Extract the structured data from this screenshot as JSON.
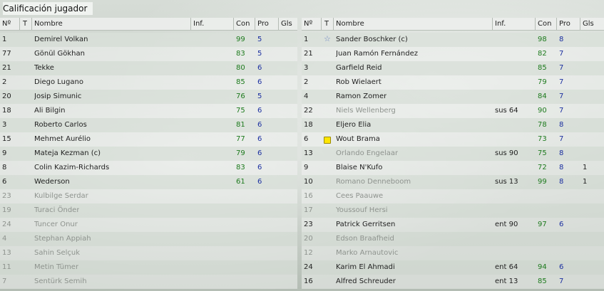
{
  "title": "Calificación jugador",
  "columns": {
    "num": "Nº",
    "t": "T",
    "name": "Nombre",
    "inf": "Inf.",
    "con": "Con",
    "pro": "Pro",
    "gls": "Gls"
  },
  "left_team": [
    {
      "num": "1",
      "name": "Demirel Volkan",
      "inf": "",
      "con": "99",
      "pro": "5",
      "gls": "",
      "played": true,
      "icon": ""
    },
    {
      "num": "77",
      "name": "Gönül Gökhan",
      "inf": "",
      "con": "83",
      "pro": "5",
      "gls": "",
      "played": true,
      "icon": ""
    },
    {
      "num": "21",
      "name": "Tekke",
      "inf": "",
      "con": "80",
      "pro": "6",
      "gls": "",
      "played": true,
      "icon": ""
    },
    {
      "num": "2",
      "name": "Diego Lugano",
      "inf": "",
      "con": "85",
      "pro": "6",
      "gls": "",
      "played": true,
      "icon": ""
    },
    {
      "num": "20",
      "name": "Josip Simunic",
      "inf": "",
      "con": "76",
      "pro": "5",
      "gls": "",
      "played": true,
      "icon": ""
    },
    {
      "num": "18",
      "name": "Ali Bilgin",
      "inf": "",
      "con": "75",
      "pro": "6",
      "gls": "",
      "played": true,
      "icon": ""
    },
    {
      "num": "3",
      "name": "Roberto Carlos",
      "inf": "",
      "con": "81",
      "pro": "6",
      "gls": "",
      "played": true,
      "icon": ""
    },
    {
      "num": "15",
      "name": "Mehmet Aurélio",
      "inf": "",
      "con": "77",
      "pro": "6",
      "gls": "",
      "played": true,
      "icon": ""
    },
    {
      "num": "9",
      "name": "Mateja Kezman (c)",
      "inf": "",
      "con": "79",
      "pro": "6",
      "gls": "",
      "played": true,
      "icon": ""
    },
    {
      "num": "8",
      "name": "Colin Kazim-Richards",
      "inf": "",
      "con": "83",
      "pro": "6",
      "gls": "",
      "played": true,
      "icon": ""
    },
    {
      "num": "6",
      "name": "Wederson",
      "inf": "",
      "con": "61",
      "pro": "6",
      "gls": "",
      "played": true,
      "icon": ""
    },
    {
      "num": "23",
      "name": "Kulbilge Serdar",
      "inf": "",
      "con": "",
      "pro": "",
      "gls": "",
      "played": false,
      "icon": ""
    },
    {
      "num": "19",
      "name": "Turaci Önder",
      "inf": "",
      "con": "",
      "pro": "",
      "gls": "",
      "played": false,
      "icon": ""
    },
    {
      "num": "24",
      "name": "Tuncer Onur",
      "inf": "",
      "con": "",
      "pro": "",
      "gls": "",
      "played": false,
      "icon": ""
    },
    {
      "num": "4",
      "name": "Stephan Appiah",
      "inf": "",
      "con": "",
      "pro": "",
      "gls": "",
      "played": false,
      "icon": ""
    },
    {
      "num": "13",
      "name": "Sahin Selçuk",
      "inf": "",
      "con": "",
      "pro": "",
      "gls": "",
      "played": false,
      "icon": ""
    },
    {
      "num": "11",
      "name": "Metin Tümer",
      "inf": "",
      "con": "",
      "pro": "",
      "gls": "",
      "played": false,
      "icon": ""
    },
    {
      "num": "7",
      "name": "Sentürk Semih",
      "inf": "",
      "con": "",
      "pro": "",
      "gls": "",
      "played": false,
      "icon": ""
    }
  ],
  "right_team": [
    {
      "num": "1",
      "name": "Sander Boschker (c)",
      "inf": "",
      "con": "98",
      "pro": "8",
      "gls": "",
      "played": true,
      "icon": "star"
    },
    {
      "num": "21",
      "name": "Juan Ramón Fernández",
      "inf": "",
      "con": "82",
      "pro": "7",
      "gls": "",
      "played": true,
      "icon": ""
    },
    {
      "num": "3",
      "name": "Garfield Reid",
      "inf": "",
      "con": "85",
      "pro": "7",
      "gls": "",
      "played": true,
      "icon": ""
    },
    {
      "num": "2",
      "name": "Rob Wielaert",
      "inf": "",
      "con": "79",
      "pro": "7",
      "gls": "",
      "played": true,
      "icon": ""
    },
    {
      "num": "4",
      "name": "Ramon Zomer",
      "inf": "",
      "con": "84",
      "pro": "7",
      "gls": "",
      "played": true,
      "icon": ""
    },
    {
      "num": "22",
      "name": "Niels Wellenberg",
      "inf": "sus 64",
      "con": "90",
      "pro": "7",
      "gls": "",
      "played": true,
      "faded": true,
      "icon": ""
    },
    {
      "num": "18",
      "name": "Eljero Elia",
      "inf": "",
      "con": "78",
      "pro": "8",
      "gls": "",
      "played": true,
      "icon": ""
    },
    {
      "num": "6",
      "name": "Wout Brama",
      "inf": "",
      "con": "73",
      "pro": "7",
      "gls": "",
      "played": true,
      "icon": "yellow-card"
    },
    {
      "num": "13",
      "name": "Orlando Engelaar",
      "inf": "sus 90",
      "con": "75",
      "pro": "8",
      "gls": "",
      "played": true,
      "faded": true,
      "icon": ""
    },
    {
      "num": "9",
      "name": "Blaise N'Kufo",
      "inf": "",
      "con": "72",
      "pro": "8",
      "gls": "1",
      "played": true,
      "icon": ""
    },
    {
      "num": "10",
      "name": "Romano Denneboom",
      "inf": "sus 13",
      "con": "99",
      "pro": "8",
      "gls": "1",
      "played": true,
      "faded": true,
      "icon": ""
    },
    {
      "num": "16",
      "name": "Cees Paauwe",
      "inf": "",
      "con": "",
      "pro": "",
      "gls": "",
      "played": false,
      "icon": ""
    },
    {
      "num": "17",
      "name": "Youssouf Hersi",
      "inf": "",
      "con": "",
      "pro": "",
      "gls": "",
      "played": false,
      "icon": ""
    },
    {
      "num": "23",
      "name": "Patrick Gerritsen",
      "inf": "ent 90",
      "con": "97",
      "pro": "6",
      "gls": "",
      "played": true,
      "icon": ""
    },
    {
      "num": "20",
      "name": "Edson Braafheid",
      "inf": "",
      "con": "",
      "pro": "",
      "gls": "",
      "played": false,
      "icon": ""
    },
    {
      "num": "12",
      "name": "Marko Arnautovic",
      "inf": "",
      "con": "",
      "pro": "",
      "gls": "",
      "played": false,
      "icon": ""
    },
    {
      "num": "24",
      "name": "Karim El Ahmadi",
      "inf": "ent 64",
      "con": "94",
      "pro": "6",
      "gls": "",
      "played": true,
      "icon": ""
    },
    {
      "num": "16",
      "name": "Alfred Schreuder",
      "inf": "ent 13",
      "con": "85",
      "pro": "7",
      "gls": "",
      "played": true,
      "icon": ""
    }
  ],
  "colors": {
    "con": "#1d7a1d",
    "pro": "#1b2fa0",
    "faded": "#8e938e",
    "yellow_card": "#ffe600",
    "star": "#6d86c4"
  }
}
